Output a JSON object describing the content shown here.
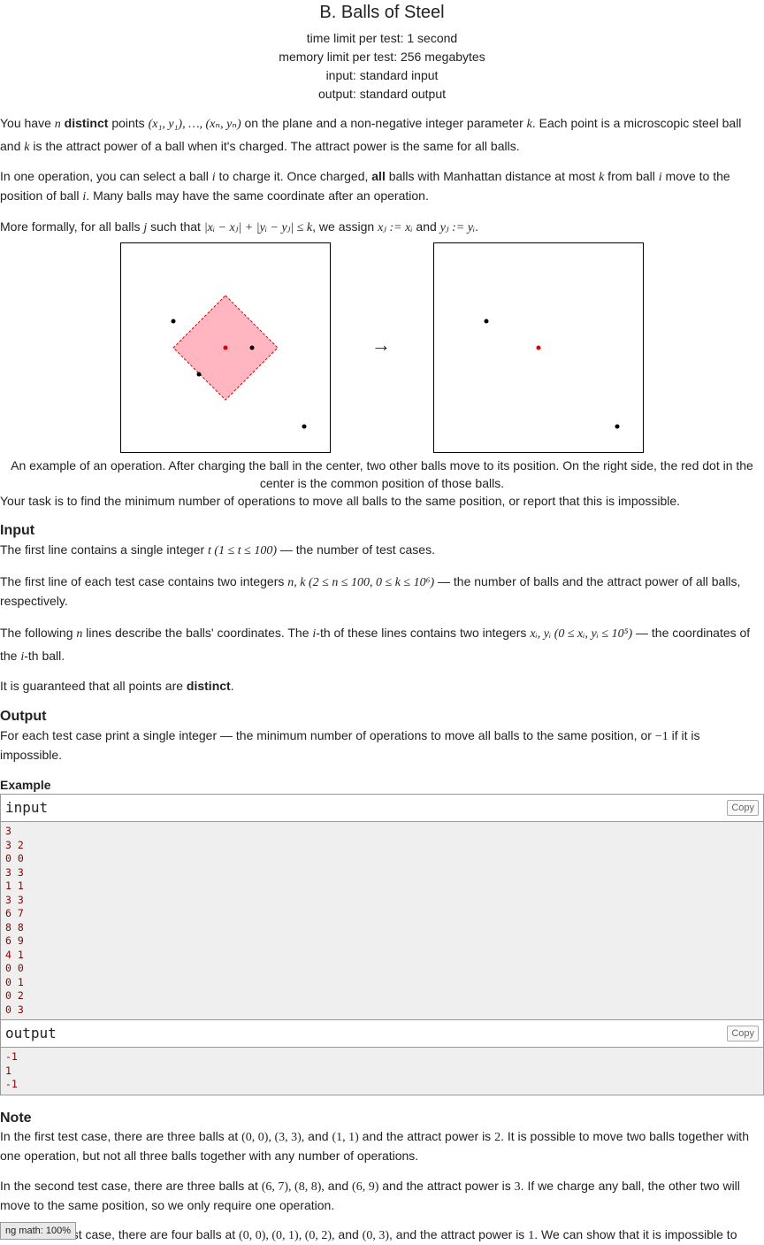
{
  "header": {
    "title": "B. Balls of Steel",
    "time_limit": "time limit per test: 1 second",
    "memory_limit": "memory limit per test: 256 megabytes",
    "input": "input: standard input",
    "output": "output: standard output"
  },
  "statement": {
    "p1_a": "You have ",
    "p1_n": "n",
    "p1_b": " distinct",
    "p1_c": " points ",
    "p1_pts": "(x₁, y₁), …, (xₙ, yₙ)",
    "p1_d": " on the plane and a non-negative integer parameter ",
    "p1_k": "k",
    "p1_e": ". Each point is a microscopic steel ball and ",
    "p1_k2": "k",
    "p1_f": " is the attract power of a ball when it's charged. The attract power is the same for all balls.",
    "p2_a": "In one operation, you can select a ball ",
    "p2_i": "i",
    "p2_b": " to charge it. Once charged, ",
    "p2_all": "all",
    "p2_c": " balls with Manhattan distance at most ",
    "p2_k": "k",
    "p2_d": " from ball ",
    "p2_i2": "i",
    "p2_e": " move to the position of ball ",
    "p2_i3": "i",
    "p2_f": ". Many balls may have the same coordinate after an operation.",
    "p3_a": "More formally, for all balls ",
    "p3_j": "j",
    "p3_b": " such that ",
    "p3_cond": "|xᵢ − xⱼ| + |yᵢ − yⱼ| ≤ k",
    "p3_c": ", we assign ",
    "p3_as1": "xⱼ := xᵢ",
    "p3_d": " and ",
    "p3_as2": "yⱼ := yᵢ",
    "p3_e": ".",
    "arrow": "→",
    "caption": "An example of an operation. After charging the ball in the center, two other balls move to its position. On the right side, the red dot in the center is the common position of those balls.",
    "task": "Your task is to find the minimum number of operations to move all balls to the same position, or report that this is impossible."
  },
  "input_section": {
    "title": "Input",
    "p1_a": "The first line contains a single integer ",
    "p1_t": "t",
    "p1_range": " (1 ≤ t ≤ 100)",
    "p1_b": " — the number of test cases.",
    "p2_a": "The first line of each test case contains two integers ",
    "p2_vars": "n, k",
    "p2_range": " (2 ≤ n ≤ 100, 0 ≤ k ≤ 10⁶)",
    "p2_b": " — the number of balls and the attract power of all balls, respectively.",
    "p3_a": "The following ",
    "p3_n": "n",
    "p3_b": " lines describe the balls' coordinates. The ",
    "p3_i": "i",
    "p3_c": "-th of these lines contains two integers ",
    "p3_vars": "xᵢ, yᵢ",
    "p3_range": " (0 ≤ xᵢ, yᵢ ≤ 10⁵)",
    "p3_d": " — the coordinates of the ",
    "p3_i2": "i",
    "p3_e": "-th ball.",
    "p4_a": "It is guaranteed that all points are ",
    "p4_b": "distinct",
    "p4_c": "."
  },
  "output_section": {
    "title": "Output",
    "p1_a": "For each test case print a single integer — the minimum number of operations to move all balls to the same position, or ",
    "p1_m": "−1",
    "p1_b": " if it is impossible."
  },
  "example": {
    "title": "Example",
    "input_label": "input",
    "output_label": "output",
    "copy_label": "Copy",
    "input_text": "3\n3 2\n0 0\n3 3\n1 1\n3 3\n6 7\n8 8\n6 9\n4 1\n0 0\n0 1\n0 2\n0 3",
    "output_text": "-1\n1\n-1"
  },
  "note": {
    "title": "Note",
    "p1_a": "In the first test case, there are three balls at ",
    "p1_pts": "(0, 0), (3, 3),",
    "p1_and": " and ",
    "p1_pt3": "(1, 1)",
    "p1_b": " and the attract power is ",
    "p1_k": "2",
    "p1_c": ". It is possible to move two balls together with one operation, but not all three balls together with any number of operations.",
    "p2_a": "In the second test case, there are three balls at ",
    "p2_pts": "(6, 7), (8, 8),",
    "p2_and": " and ",
    "p2_pt3": "(6, 9)",
    "p2_b": " and the attract power is ",
    "p2_k": "3",
    "p2_c": ". If we charge any ball, the other two will move to the same position, so we only require one operation.",
    "p3_a": "In the third test case, there are four balls at ",
    "p3_pts": "(0, 0), (0, 1), (0, 2),",
    "p3_and": " and ",
    "p3_pt4": "(0, 3)",
    "p3_b": ", and the attract power is ",
    "p3_k": "1",
    "p3_c": ". We can show that it is impossible to"
  },
  "math_badge": "ng math: 100%"
}
